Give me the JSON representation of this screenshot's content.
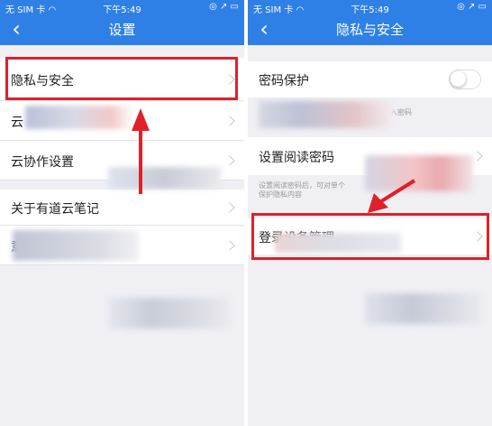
{
  "left_screen": {
    "status": {
      "carrier": "无 SIM 卡 ",
      "time": "下午5:49",
      "icons": "◎ ↗ ▭"
    },
    "back_icon": "‹",
    "title": "设置",
    "items": [
      {
        "label": "隐私与安全"
      },
      {
        "label": "云"
      },
      {
        "label": "云协作设置"
      },
      {
        "label": "关于有道云笔记"
      },
      {
        "label": "意"
      }
    ]
  },
  "right_screen": {
    "status": {
      "carrier": "无 SIM 卡 ",
      "time": "下午5:49",
      "icons": "◎ ↗ ▭"
    },
    "back_icon": "‹",
    "title": "隐私与安全",
    "password_protect": {
      "label": "密码保护",
      "desc": "输入密码"
    },
    "read_password": {
      "label": "设置阅读密码",
      "desc_line1": "设置阅读密码后，可对单个",
      "desc_line2": "保护隐私内容"
    },
    "device_manage": {
      "label": "登录设备管理"
    }
  },
  "colors": {
    "nav": "#2f80e6",
    "highlight": "#e0202a",
    "background": "#efeff4"
  }
}
